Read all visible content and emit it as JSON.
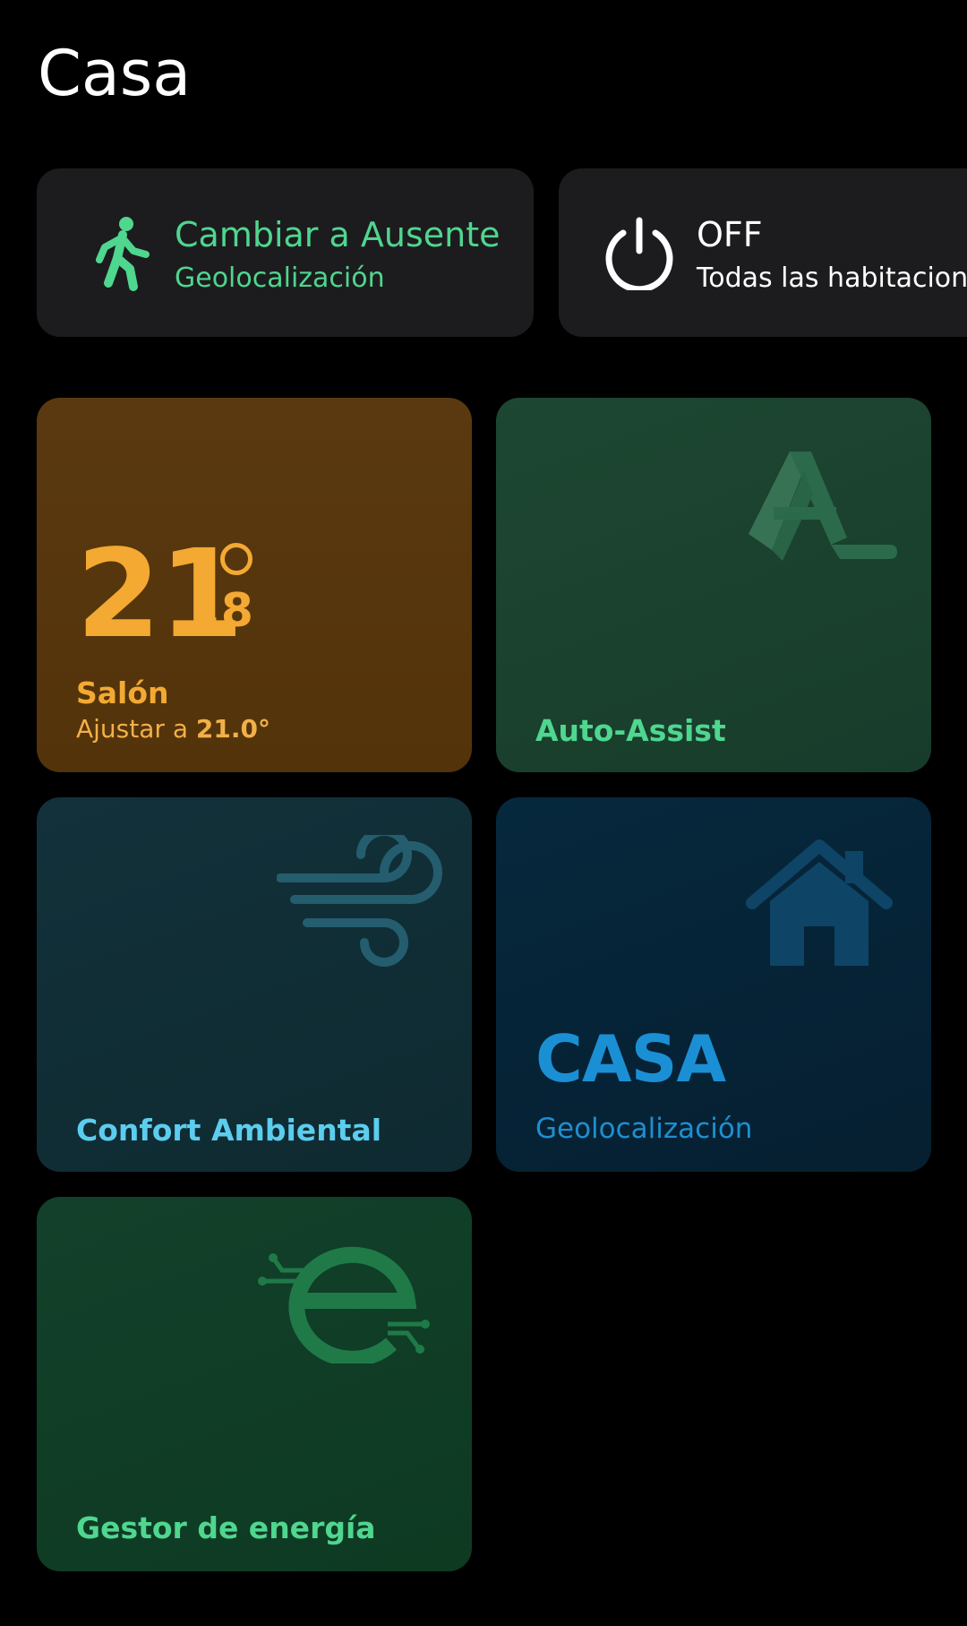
{
  "header": {
    "title": "Casa"
  },
  "chips": {
    "away": {
      "title": "Cambiar a Ausente",
      "subtitle": "Geolocalización",
      "icon": "walking-person-icon",
      "color": "#4fd68f"
    },
    "off": {
      "title": "OFF",
      "subtitle": "Todas las habitaciones",
      "icon": "power-icon",
      "color": "#ffffff"
    }
  },
  "tiles": {
    "salon": {
      "temp_integer": "21",
      "temp_decimal": ".8",
      "name": "Salón",
      "setpoint_prefix": "Ajustar a ",
      "setpoint_value": "21.0°",
      "color": "#f3a932"
    },
    "auto_assist": {
      "label": "Auto-Assist",
      "icon": "auto-assist-logo-icon",
      "color": "#4fd68f"
    },
    "confort": {
      "label": "Confort Ambiental",
      "icon": "wind-icon",
      "color": "#5ccdee"
    },
    "casa": {
      "status": "CASA",
      "label": "Geolocalización",
      "icon": "house-icon",
      "color": "#1b8fd4"
    },
    "energia": {
      "label": "Gestor de energía",
      "icon": "energy-e-icon",
      "color": "#4fd68f"
    }
  }
}
